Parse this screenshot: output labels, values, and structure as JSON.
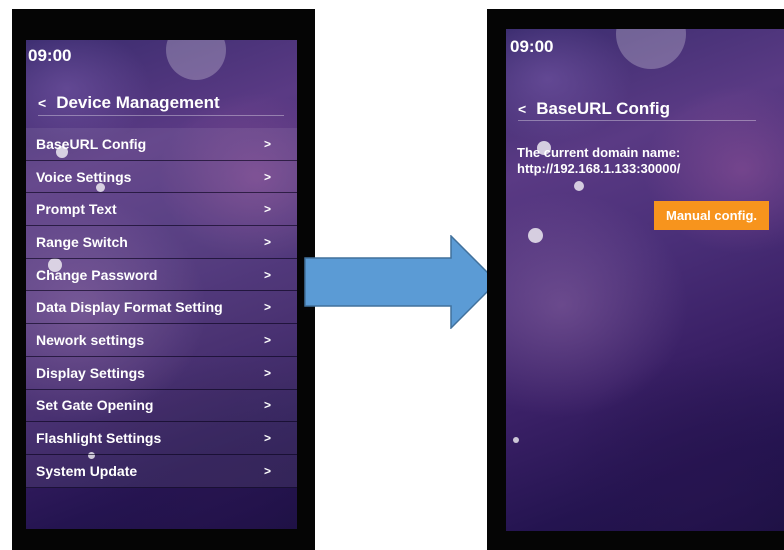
{
  "left_screen": {
    "time": "09:00",
    "back_symbol": "<",
    "title": "Device Management",
    "menu_items": [
      {
        "label": "BaseURL Config",
        "chevron": ">"
      },
      {
        "label": "Voice Settings",
        "chevron": ">"
      },
      {
        "label": "Prompt Text",
        "chevron": ">"
      },
      {
        "label": "Range Switch",
        "chevron": ">"
      },
      {
        "label": "Change Password",
        "chevron": ">"
      },
      {
        "label": "Data Display Format Setting",
        "chevron": ">"
      },
      {
        "label": "Nework settings",
        "chevron": ">"
      },
      {
        "label": "Display Settings",
        "chevron": ">"
      },
      {
        "label": "Set Gate Opening",
        "chevron": ">"
      },
      {
        "label": "Flashlight Settings",
        "chevron": ">"
      },
      {
        "label": "System Update",
        "chevron": ">"
      }
    ]
  },
  "transition_arrow": {
    "icon": "right-arrow-icon",
    "color": "#5b9bd5"
  },
  "right_screen": {
    "time": "09:00",
    "back_symbol": "<",
    "title": "BaseURL Config",
    "domain_label": "The current domain name:",
    "domain_value": "http://192.168.1.133:30000/",
    "manual_button": "Manual config.",
    "button_color": "#f7941d"
  }
}
